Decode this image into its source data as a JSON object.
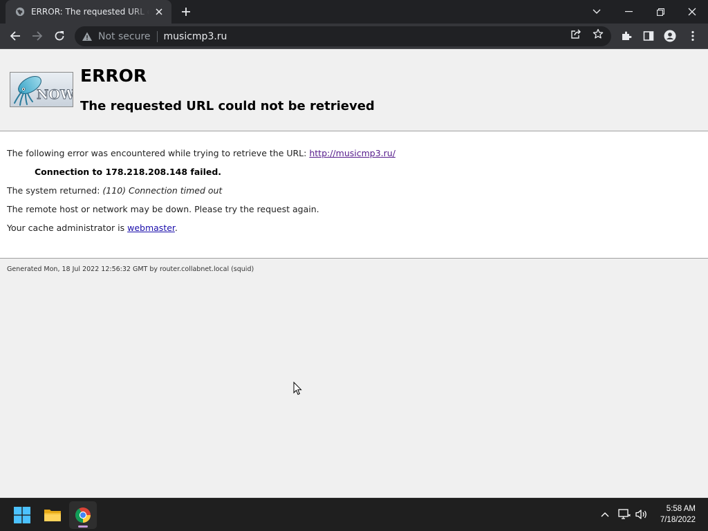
{
  "browser": {
    "tab_title": "ERROR: The requested URL could not be retrieved",
    "security_label": "Not secure",
    "url": "musicmp3.ru"
  },
  "page": {
    "heading": "ERROR",
    "subheading": "The requested URL could not be retrieved",
    "line1_prefix": "The following error was encountered while trying to retrieve the URL: ",
    "line1_link": "http://musicmp3.ru/",
    "connection_failed": "Connection to 178.218.208.148 failed.",
    "system_returned_prefix": "The system returned: ",
    "system_returned_error": "(110) Connection timed out",
    "remote_down": "The remote host or network may be down. Please try the request again.",
    "cache_admin_prefix": "Your cache administrator is ",
    "cache_admin_link": "webmaster",
    "cache_admin_suffix": ".",
    "footer": "Generated Mon, 18 Jul 2022 12:56:32 GMT by router.collabnet.local (squid)",
    "logo_text": "NOW"
  },
  "taskbar": {
    "time": "5:58 AM",
    "date": "7/18/2022"
  },
  "colors": {
    "link": "#1a0dab",
    "visited_link": "#551a8b",
    "chrome_dark": "#202124",
    "chrome_toolbar": "#35363a"
  }
}
